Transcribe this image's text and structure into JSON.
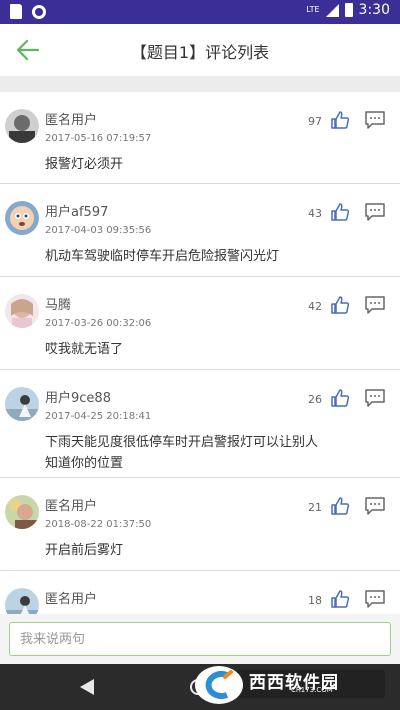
{
  "status_bar": {
    "network": "LTE",
    "time": "3:30"
  },
  "header": {
    "title": "【题目1】评论列表",
    "back_icon": "arrow-left-icon",
    "accent_color": "#5cb85c"
  },
  "comments": [
    {
      "username": "匿名用户",
      "time": "2017-05-16 07:19:57",
      "content": "报警灯必须开",
      "likes": "97"
    },
    {
      "username": "用户af597",
      "time": "2017-04-03 09:35:56",
      "content": "机动车驾驶临时停车开启危险报警闪光灯",
      "likes": "43"
    },
    {
      "username": "马腾",
      "time": "2017-03-26 00:32:06",
      "content": "哎我就无语了",
      "likes": "42"
    },
    {
      "username": "用户9ce88",
      "time": "2017-04-25 20:18:41",
      "content": "下雨天能见度很低停车时开启警报灯可以让别人知道你的位置",
      "likes": "26"
    },
    {
      "username": "匿名用户",
      "time": "2018-08-22 01:37:50",
      "content": "开启前后雾灯",
      "likes": "21"
    },
    {
      "username": "匿名用户",
      "time": "",
      "content": "",
      "likes": "18"
    }
  ],
  "input": {
    "placeholder": "我来说两句"
  },
  "watermark": {
    "text": "西西软件园",
    "sub": "CR173.COM"
  }
}
